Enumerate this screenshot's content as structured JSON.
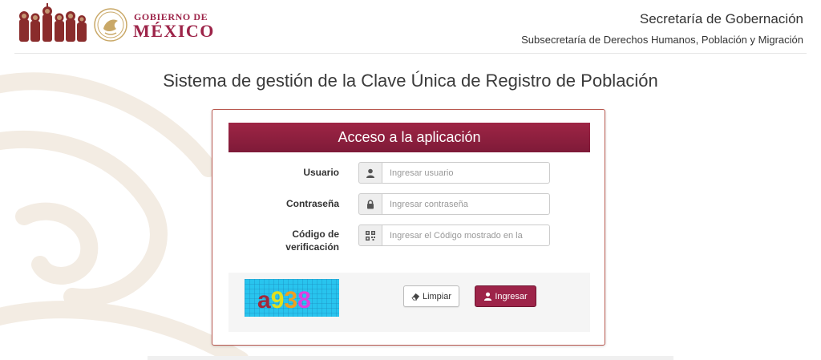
{
  "header": {
    "gov_top": "GOBIERNO DE",
    "gov_bottom": "MÉXICO",
    "secretaria": "Secretaría de Gobernación",
    "subsecretaria": "Subsecretaría de Derechos Humanos, Población y Migración"
  },
  "system_title": "Sistema de gestión de la Clave Única de Registro de Población",
  "login": {
    "heading": "Acceso a la aplicación",
    "fields": [
      {
        "label": "Usuario",
        "placeholder": "Ingresar usuario",
        "icon": "user-icon"
      },
      {
        "label": "Contraseña",
        "placeholder": "Ingresar contraseña",
        "icon": "lock-icon"
      },
      {
        "label": "Código de verificación",
        "placeholder": "Ingresar el Código mostrado en la",
        "icon": "qrcode-icon"
      }
    ],
    "captcha_text": "a938",
    "buttons": {
      "clear": "Limpiar",
      "submit": "Ingresar"
    }
  },
  "colors": {
    "brand": "#9d2449",
    "panel_border": "#b8574e",
    "captcha_bg": "#28c4ee"
  }
}
